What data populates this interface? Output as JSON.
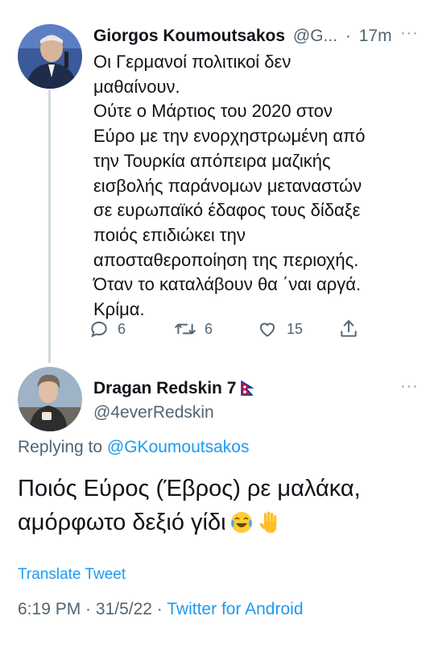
{
  "parent_tweet": {
    "author_name": "Giorgos Koumoutsakos",
    "handle_truncated": "@G...",
    "separator": "·",
    "time": "17m",
    "more": "···",
    "text_lines": [
      "Οι Γερμανοί πολιτικοί δεν",
      "μαθαίνουν.",
      "Ούτε ο Μάρτιος του 2020 στον",
      "Εύρο με την ενορχηστρωμένη από",
      "την Τουρκία απόπειρα μαζικής",
      "εισβολής παράνομων μεταναστών",
      "σε ευρωπαϊκό έδαφος τους δίδαξε",
      "ποιός επιδιώκει την",
      "αποσταθεροποίηση της περιοχής.",
      "Όταν το καταλάβουν θα ΄ναι αργά.",
      "Κρίμα."
    ],
    "actions": {
      "reply_count": "6",
      "retweet_count": "6",
      "like_count": "15"
    }
  },
  "reply_tweet": {
    "author_name": "Dragan Redskin 7",
    "handle": "@4everRedskin",
    "more": "···",
    "replying_to_label": "Replying to",
    "replying_to_handle": "@GKoumoutsakos",
    "text_lines": [
      "Ποιός Εύρος (Έβρος) ρε μαλάκα,",
      "αμόρφωτο δεξιό γίδι"
    ],
    "translate_label": "Translate Tweet",
    "time": "6:19 PM",
    "separator1": " · ",
    "date": "31/5/22",
    "separator2": " · ",
    "client": "Twitter for Android"
  },
  "icons": {
    "reply": "reply-icon",
    "retweet": "retweet-icon",
    "like": "heart-icon",
    "share": "share-icon",
    "flag": "nepal-flag-icon",
    "emoji_laugh": "tears-of-joy-emoji",
    "emoji_hand": "raised-hand-emoji"
  },
  "colors": {
    "text": "#0f1419",
    "secondary": "#536471",
    "link": "#1d9bf0",
    "thread_line": "#cfd9de"
  }
}
